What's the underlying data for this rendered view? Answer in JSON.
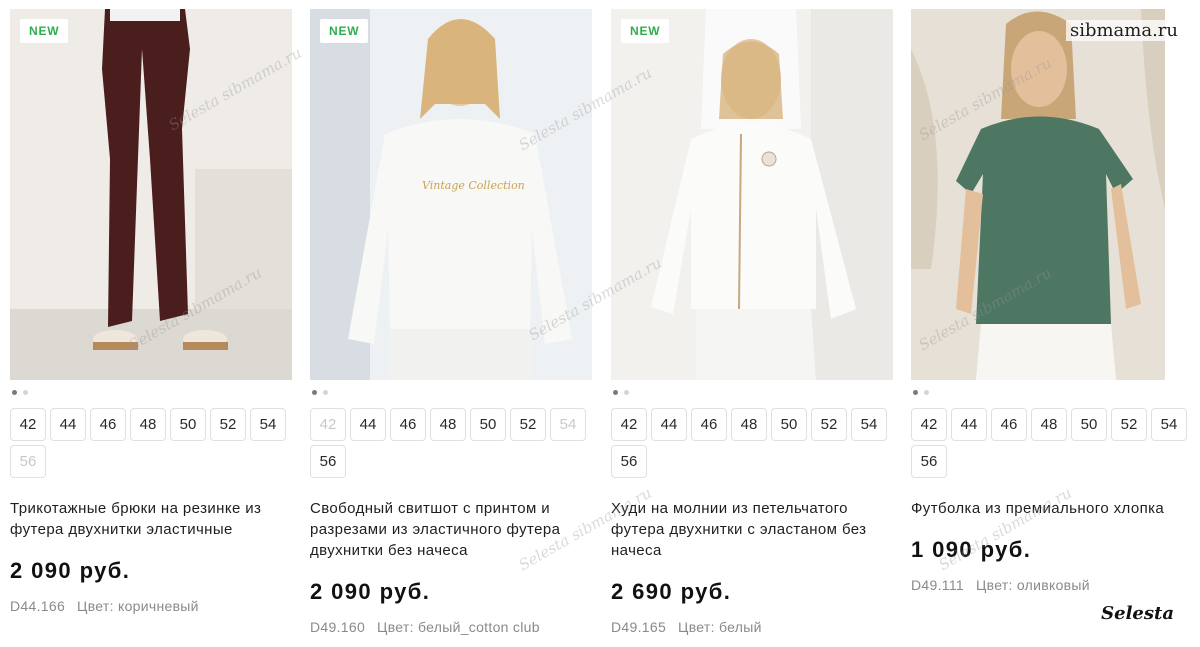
{
  "watermarks": {
    "top_right": "sibmama.ru",
    "bottom_right": "Selesta",
    "diagonal": "Selesta sibmama.ru"
  },
  "products": [
    {
      "badge": "NEW",
      "image_icon": "brown-trousers-photo",
      "sizes": [
        {
          "label": "42",
          "available": true
        },
        {
          "label": "44",
          "available": true
        },
        {
          "label": "46",
          "available": true
        },
        {
          "label": "48",
          "available": true
        },
        {
          "label": "50",
          "available": true
        },
        {
          "label": "52",
          "available": true
        },
        {
          "label": "54",
          "available": true
        },
        {
          "label": "56",
          "available": false
        }
      ],
      "title": "Трикотажные брюки на резинке из футера двухнитки эластичные",
      "price": "2 090 руб.",
      "article": "D44.166",
      "color": "Цвет: коричневый"
    },
    {
      "badge": "NEW",
      "image_icon": "white-sweatshirt-photo",
      "sizes": [
        {
          "label": "42",
          "available": false
        },
        {
          "label": "44",
          "available": true
        },
        {
          "label": "46",
          "available": true
        },
        {
          "label": "48",
          "available": true
        },
        {
          "label": "50",
          "available": true
        },
        {
          "label": "52",
          "available": true
        },
        {
          "label": "54",
          "available": false
        },
        {
          "label": "56",
          "available": true
        }
      ],
      "title": "Свободный свитшот с принтом и разрезами из эластичного футера двухнитки без начеса",
      "price": "2 090 руб.",
      "article": "D49.160",
      "color": "Цвет: белый_cotton club"
    },
    {
      "badge": "NEW",
      "image_icon": "white-hoodie-photo",
      "sizes": [
        {
          "label": "42",
          "available": true
        },
        {
          "label": "44",
          "available": true
        },
        {
          "label": "46",
          "available": true
        },
        {
          "label": "48",
          "available": true
        },
        {
          "label": "50",
          "available": true
        },
        {
          "label": "52",
          "available": true
        },
        {
          "label": "54",
          "available": true
        },
        {
          "label": "56",
          "available": true
        }
      ],
      "title": "Худи на молнии из петельчатого футера двухнитки с эластаном без начеса",
      "price": "2 690 руб.",
      "article": "D49.165",
      "color": "Цвет: белый"
    },
    {
      "badge": "",
      "image_icon": "green-tshirt-photo",
      "sizes": [
        {
          "label": "42",
          "available": true
        },
        {
          "label": "44",
          "available": true
        },
        {
          "label": "46",
          "available": true
        },
        {
          "label": "48",
          "available": true
        },
        {
          "label": "50",
          "available": true
        },
        {
          "label": "52",
          "available": true
        },
        {
          "label": "54",
          "available": true
        },
        {
          "label": "56",
          "available": true
        }
      ],
      "title": "Футболка из премиального хлопка",
      "price": "1 090 руб.",
      "article": "D49.111",
      "color": "Цвет: оливковый"
    }
  ]
}
